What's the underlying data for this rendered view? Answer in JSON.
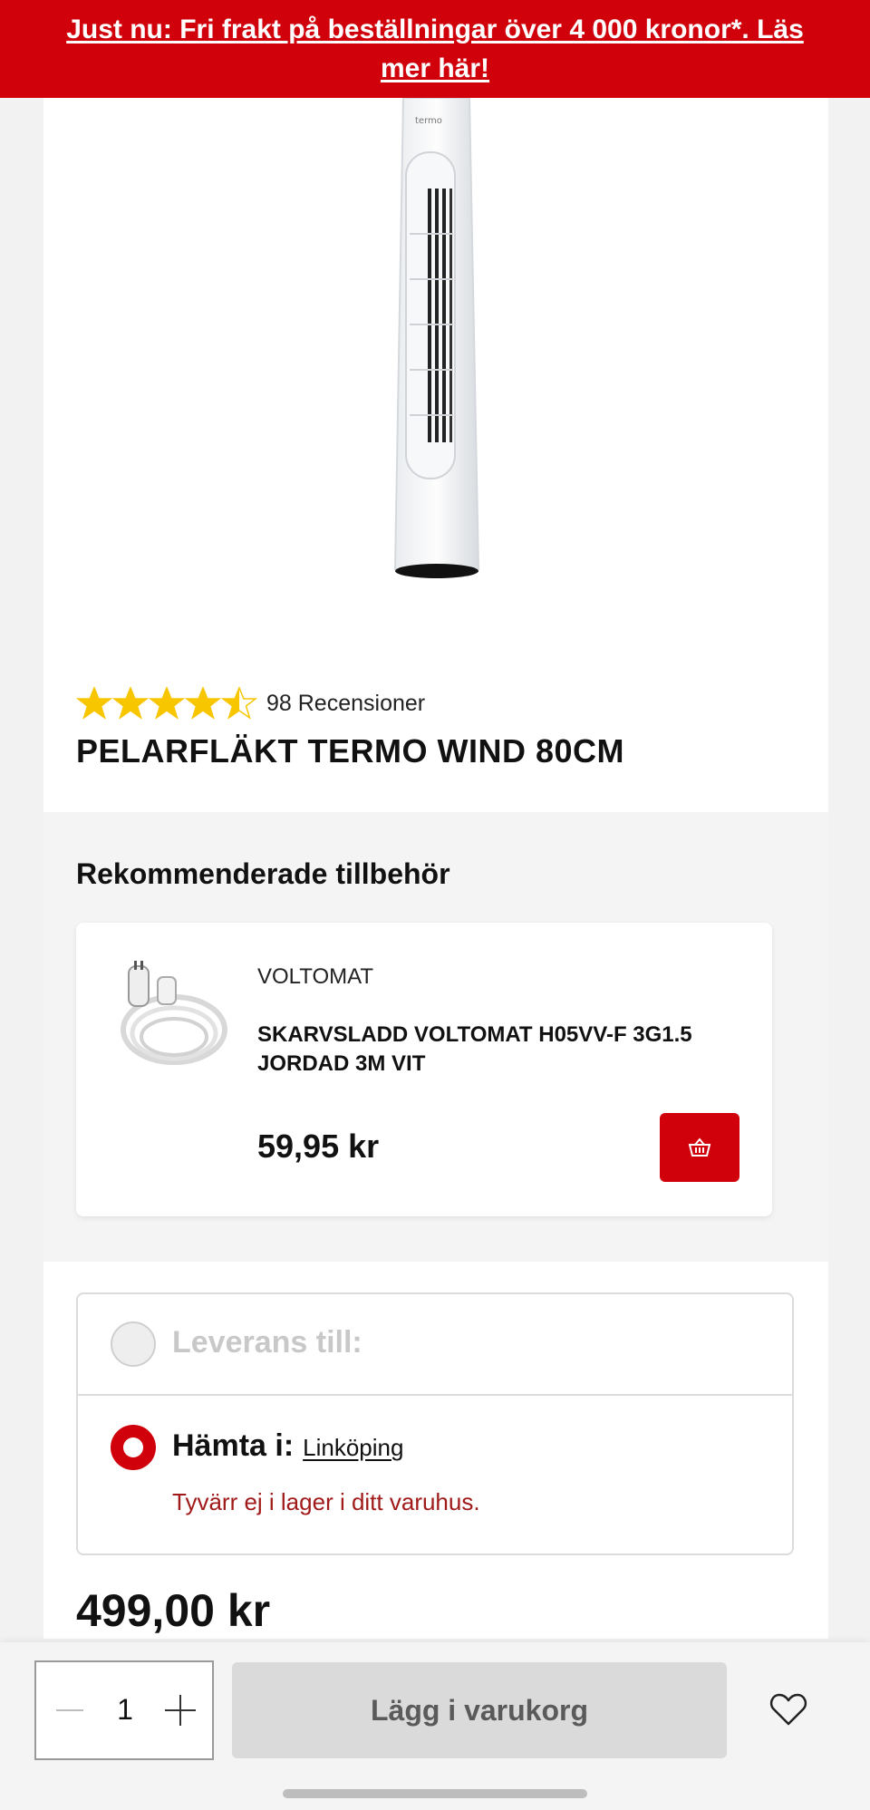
{
  "banner": {
    "text": "Just nu: Fri frakt på beställningar över 4 000 kronor*. Läs mer här!"
  },
  "product": {
    "rating": 4.5,
    "rating_max": 5,
    "reviews_label": "98 Recensioner",
    "title": "PELARFLÄKT TERMO WIND 80CM",
    "image_logo": "termo",
    "price": "499,00 kr"
  },
  "accessories": {
    "heading": "Rekommenderade tillbehör",
    "items": [
      {
        "brand": "VOLTOMAT",
        "name": "SKARVSLADD VOLTOMAT H05VV-F 3G1.5 JORDAD 3M VIT",
        "price": "59,95 kr",
        "button_icon": "basket-icon"
      }
    ]
  },
  "delivery": {
    "option_delivery_label": "Leverans till:",
    "option_pickup_label": "Hämta i:",
    "store": "Linköping",
    "stock_message": "Tyvärr ej i lager i ditt varuhus.",
    "selected": "pickup"
  },
  "bottom_bar": {
    "quantity": "1",
    "add_to_cart_label": "Lägg i varukorg",
    "favorite_icon": "heart-icon"
  },
  "colors": {
    "brand_red": "#d0010b",
    "star": "#f7c600",
    "error": "#a01a1a"
  }
}
